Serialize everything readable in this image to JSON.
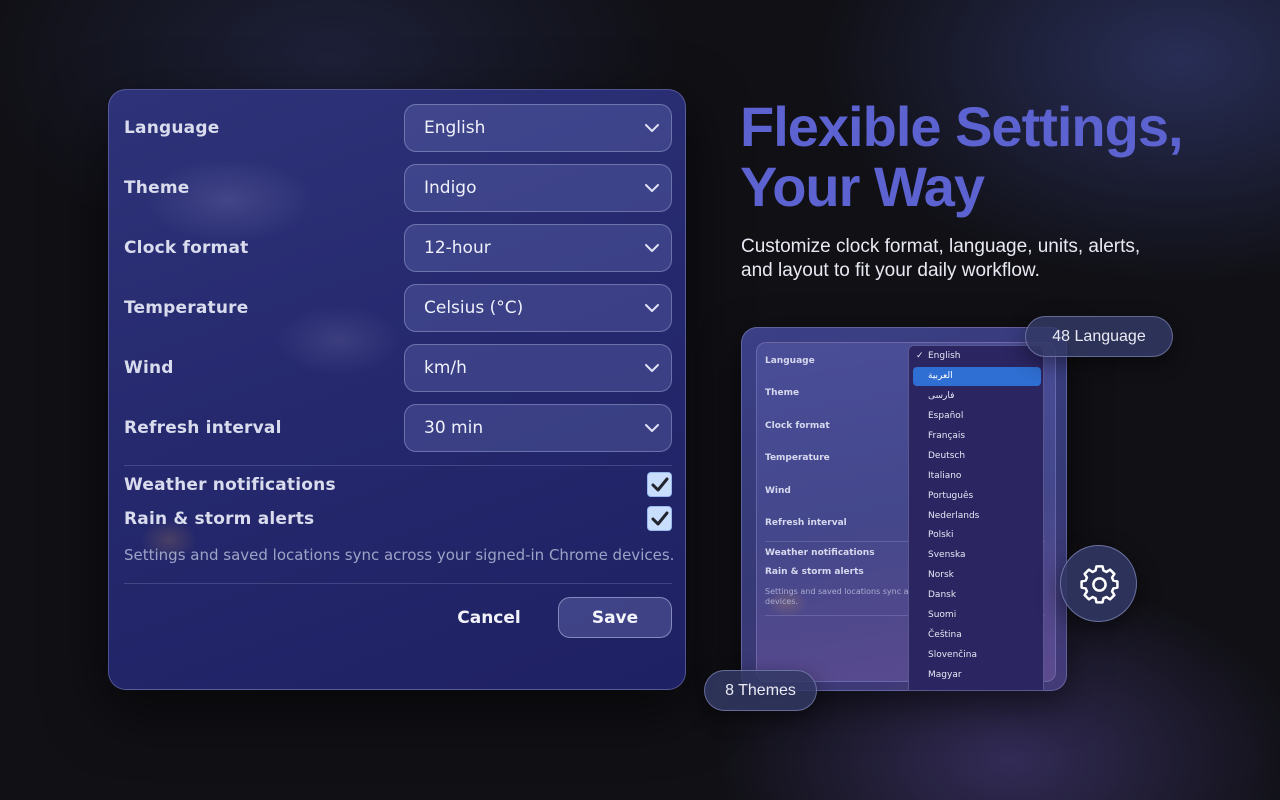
{
  "settings": {
    "rows": [
      {
        "label": "Language",
        "value": "English"
      },
      {
        "label": "Theme",
        "value": "Indigo"
      },
      {
        "label": "Clock format",
        "value": "12-hour"
      },
      {
        "label": "Temperature",
        "value": "Celsius (°C)"
      },
      {
        "label": "Wind",
        "value": "km/h"
      },
      {
        "label": "Refresh interval",
        "value": "30 min"
      }
    ],
    "toggles": [
      {
        "label": "Weather notifications",
        "checked": true
      },
      {
        "label": "Rain & storm alerts",
        "checked": true
      }
    ],
    "sync_note": "Settings and saved locations sync across your signed-in Chrome devices.",
    "cancel_label": "Cancel",
    "save_label": "Save"
  },
  "headline": {
    "line1": "Flexible Settings,",
    "line2": "Your Way",
    "sub_line1": "Customize clock format, language, units, alerts,",
    "sub_line2": "and layout to fit your daily workflow.",
    "color": "#5c63d0"
  },
  "preview": {
    "labels": [
      "Language",
      "Theme",
      "Clock format",
      "Temperature",
      "Wind",
      "Refresh interval"
    ],
    "toggles": [
      "Weather notifications",
      "Rain & storm alerts"
    ],
    "note": "Settings and saved locations sync ac devices.",
    "languages": [
      "English",
      "العربية",
      "فارسی",
      "Español",
      "Français",
      "Deutsch",
      "Italiano",
      "Português",
      "Nederlands",
      "Polski",
      "Svenska",
      "Norsk",
      "Dansk",
      "Suomi",
      "Čeština",
      "Slovenčina",
      "Magyar"
    ],
    "checked_language": "English",
    "highlighted_language": "العربية",
    "highlight_color": "#2f6ed2"
  },
  "badges": {
    "languages": "48 Language",
    "themes": "8 Themes",
    "gear_icon": "gear-icon"
  }
}
